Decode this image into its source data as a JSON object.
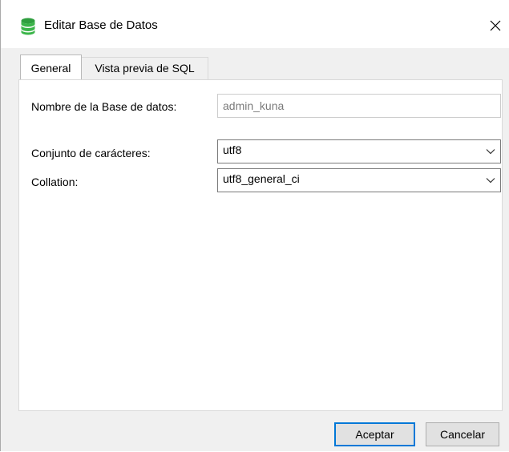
{
  "window": {
    "title": "Editar Base de Datos",
    "app_icon": "database-icon",
    "close_glyph": "✕"
  },
  "tabs": [
    {
      "label": "General",
      "active": true
    },
    {
      "label": "Vista previa de SQL",
      "active": false
    }
  ],
  "form": {
    "db_name_label": "Nombre de la Base de datos:",
    "db_name_value": "admin_kuna",
    "charset_label": "Conjunto de carácteres:",
    "charset_value": "utf8",
    "collation_label": "Collation:",
    "collation_value": "utf8_general_ci"
  },
  "buttons": {
    "ok": "Aceptar",
    "cancel": "Cancelar"
  },
  "colors": {
    "accent": "#0078d7",
    "db_icon": "#2e9e3e"
  }
}
